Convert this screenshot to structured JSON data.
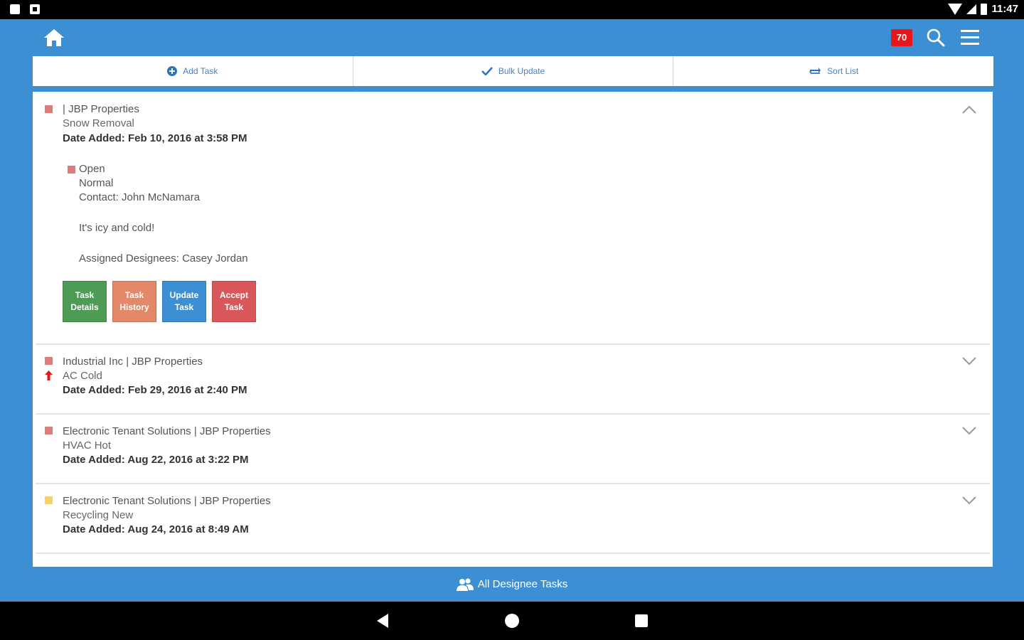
{
  "status_bar": {
    "time": "11:47"
  },
  "header": {
    "notification_count": "70"
  },
  "toolbar": {
    "add_task": "Add Task",
    "bulk_update": "Bulk Update",
    "sort_list": "Sort List"
  },
  "tasks": [
    {
      "title": "| JBP Properties",
      "subject": "Snow Removal",
      "date": "Date Added: Feb 10, 2016 at 3:58 PM",
      "flag_color": "#e07b7b",
      "expanded": true,
      "status": "Open",
      "priority": "Normal",
      "contact": "Contact: John McNamara",
      "note": "It's icy and cold!",
      "assigned": "Assigned Designees: Casey Jordan",
      "buttons": {
        "details": "Task Details",
        "history": "Task History",
        "update": "Update Task",
        "accept": "Accept Task"
      }
    },
    {
      "title": "Industrial Inc | JBP Properties",
      "subject": "AC Cold",
      "date": "Date Added: Feb 29, 2016 at 2:40 PM",
      "flag_color": "#e07b7b",
      "priority_icon": "red-up-arrow"
    },
    {
      "title": "Electronic Tenant Solutions | JBP Properties",
      "subject": "HVAC Hot",
      "date": "Date Added: Aug 22, 2016 at 3:22 PM",
      "flag_color": "#e07b7b"
    },
    {
      "title": "Electronic Tenant Solutions | JBP Properties",
      "subject": "Recycling New",
      "date": "Date Added: Aug 24, 2016 at 8:49 AM",
      "flag_color": "#f3d36b"
    }
  ],
  "footer": {
    "label": "All Designee Tasks"
  },
  "colors": {
    "primary": "#3d8fd3",
    "details_button": "#4d9b55",
    "history_button": "#e3896a",
    "update_button": "#3d8fd3",
    "accept_button": "#d9575a",
    "badge": "#e8161b"
  }
}
